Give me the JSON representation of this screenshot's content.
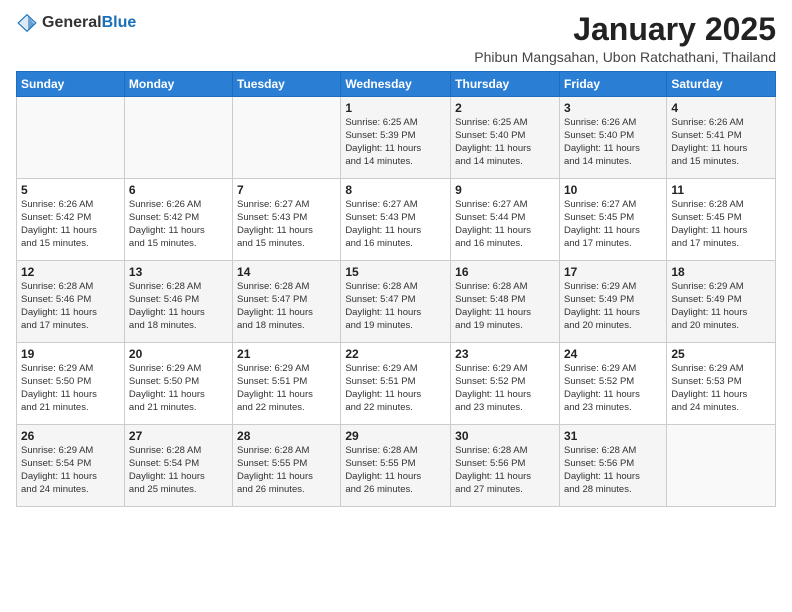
{
  "header": {
    "logo_general": "General",
    "logo_blue": "Blue",
    "month_title": "January 2025",
    "location": "Phibun Mangsahan, Ubon Ratchathani, Thailand"
  },
  "weekdays": [
    "Sunday",
    "Monday",
    "Tuesday",
    "Wednesday",
    "Thursday",
    "Friday",
    "Saturday"
  ],
  "weeks": [
    [
      {
        "day": "",
        "info": ""
      },
      {
        "day": "",
        "info": ""
      },
      {
        "day": "",
        "info": ""
      },
      {
        "day": "1",
        "info": "Sunrise: 6:25 AM\nSunset: 5:39 PM\nDaylight: 11 hours\nand 14 minutes."
      },
      {
        "day": "2",
        "info": "Sunrise: 6:25 AM\nSunset: 5:40 PM\nDaylight: 11 hours\nand 14 minutes."
      },
      {
        "day": "3",
        "info": "Sunrise: 6:26 AM\nSunset: 5:40 PM\nDaylight: 11 hours\nand 14 minutes."
      },
      {
        "day": "4",
        "info": "Sunrise: 6:26 AM\nSunset: 5:41 PM\nDaylight: 11 hours\nand 15 minutes."
      }
    ],
    [
      {
        "day": "5",
        "info": "Sunrise: 6:26 AM\nSunset: 5:42 PM\nDaylight: 11 hours\nand 15 minutes."
      },
      {
        "day": "6",
        "info": "Sunrise: 6:26 AM\nSunset: 5:42 PM\nDaylight: 11 hours\nand 15 minutes."
      },
      {
        "day": "7",
        "info": "Sunrise: 6:27 AM\nSunset: 5:43 PM\nDaylight: 11 hours\nand 15 minutes."
      },
      {
        "day": "8",
        "info": "Sunrise: 6:27 AM\nSunset: 5:43 PM\nDaylight: 11 hours\nand 16 minutes."
      },
      {
        "day": "9",
        "info": "Sunrise: 6:27 AM\nSunset: 5:44 PM\nDaylight: 11 hours\nand 16 minutes."
      },
      {
        "day": "10",
        "info": "Sunrise: 6:27 AM\nSunset: 5:45 PM\nDaylight: 11 hours\nand 17 minutes."
      },
      {
        "day": "11",
        "info": "Sunrise: 6:28 AM\nSunset: 5:45 PM\nDaylight: 11 hours\nand 17 minutes."
      }
    ],
    [
      {
        "day": "12",
        "info": "Sunrise: 6:28 AM\nSunset: 5:46 PM\nDaylight: 11 hours\nand 17 minutes."
      },
      {
        "day": "13",
        "info": "Sunrise: 6:28 AM\nSunset: 5:46 PM\nDaylight: 11 hours\nand 18 minutes."
      },
      {
        "day": "14",
        "info": "Sunrise: 6:28 AM\nSunset: 5:47 PM\nDaylight: 11 hours\nand 18 minutes."
      },
      {
        "day": "15",
        "info": "Sunrise: 6:28 AM\nSunset: 5:47 PM\nDaylight: 11 hours\nand 19 minutes."
      },
      {
        "day": "16",
        "info": "Sunrise: 6:28 AM\nSunset: 5:48 PM\nDaylight: 11 hours\nand 19 minutes."
      },
      {
        "day": "17",
        "info": "Sunrise: 6:29 AM\nSunset: 5:49 PM\nDaylight: 11 hours\nand 20 minutes."
      },
      {
        "day": "18",
        "info": "Sunrise: 6:29 AM\nSunset: 5:49 PM\nDaylight: 11 hours\nand 20 minutes."
      }
    ],
    [
      {
        "day": "19",
        "info": "Sunrise: 6:29 AM\nSunset: 5:50 PM\nDaylight: 11 hours\nand 21 minutes."
      },
      {
        "day": "20",
        "info": "Sunrise: 6:29 AM\nSunset: 5:50 PM\nDaylight: 11 hours\nand 21 minutes."
      },
      {
        "day": "21",
        "info": "Sunrise: 6:29 AM\nSunset: 5:51 PM\nDaylight: 11 hours\nand 22 minutes."
      },
      {
        "day": "22",
        "info": "Sunrise: 6:29 AM\nSunset: 5:51 PM\nDaylight: 11 hours\nand 22 minutes."
      },
      {
        "day": "23",
        "info": "Sunrise: 6:29 AM\nSunset: 5:52 PM\nDaylight: 11 hours\nand 23 minutes."
      },
      {
        "day": "24",
        "info": "Sunrise: 6:29 AM\nSunset: 5:52 PM\nDaylight: 11 hours\nand 23 minutes."
      },
      {
        "day": "25",
        "info": "Sunrise: 6:29 AM\nSunset: 5:53 PM\nDaylight: 11 hours\nand 24 minutes."
      }
    ],
    [
      {
        "day": "26",
        "info": "Sunrise: 6:29 AM\nSunset: 5:54 PM\nDaylight: 11 hours\nand 24 minutes."
      },
      {
        "day": "27",
        "info": "Sunrise: 6:28 AM\nSunset: 5:54 PM\nDaylight: 11 hours\nand 25 minutes."
      },
      {
        "day": "28",
        "info": "Sunrise: 6:28 AM\nSunset: 5:55 PM\nDaylight: 11 hours\nand 26 minutes."
      },
      {
        "day": "29",
        "info": "Sunrise: 6:28 AM\nSunset: 5:55 PM\nDaylight: 11 hours\nand 26 minutes."
      },
      {
        "day": "30",
        "info": "Sunrise: 6:28 AM\nSunset: 5:56 PM\nDaylight: 11 hours\nand 27 minutes."
      },
      {
        "day": "31",
        "info": "Sunrise: 6:28 AM\nSunset: 5:56 PM\nDaylight: 11 hours\nand 28 minutes."
      },
      {
        "day": "",
        "info": ""
      }
    ]
  ]
}
